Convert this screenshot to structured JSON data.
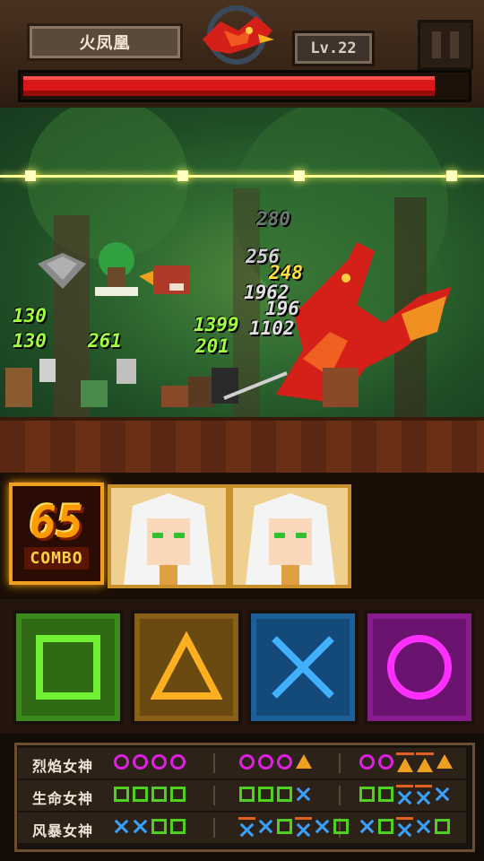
{
  "boss": {
    "name": "火凤凰",
    "level": "Lv.22",
    "hp_fraction": 0.93
  },
  "damage_numbers": [
    "280",
    "256",
    "248",
    "1962",
    "196",
    "1102",
    "1399",
    "201",
    "130",
    "130",
    "261"
  ],
  "combo": {
    "count": "65",
    "label": "COMBO"
  },
  "buttons": [
    {
      "name": "square-button",
      "color": "#50d020"
    },
    {
      "name": "triangle-button",
      "color": "#f0a020"
    },
    {
      "name": "cross-button",
      "color": "#3aa0ff"
    },
    {
      "name": "circle-button",
      "color": "#e020e0"
    }
  ],
  "sequences": [
    {
      "label": "烈焰女神",
      "groups": [
        [
          "o",
          "o",
          "o",
          "o"
        ],
        [
          "o",
          "o",
          "o",
          "tri"
        ],
        [
          "o",
          "o",
          "tri*",
          "tri*",
          "tri"
        ]
      ]
    },
    {
      "label": "生命女神",
      "groups": [
        [
          "sq",
          "sq",
          "sq",
          "sq"
        ],
        [
          "sq",
          "sq",
          "sq",
          "x"
        ],
        [
          "sq",
          "sq",
          "x*",
          "x*",
          "x"
        ]
      ]
    },
    {
      "label": "风暴女神",
      "groups": [
        [
          "x",
          "x",
          "sq",
          "sq"
        ],
        [
          "x*",
          "x",
          "sq",
          "x*",
          "x",
          "sq"
        ],
        [
          "x",
          "sq",
          "x*",
          "x",
          "sq"
        ]
      ]
    }
  ]
}
